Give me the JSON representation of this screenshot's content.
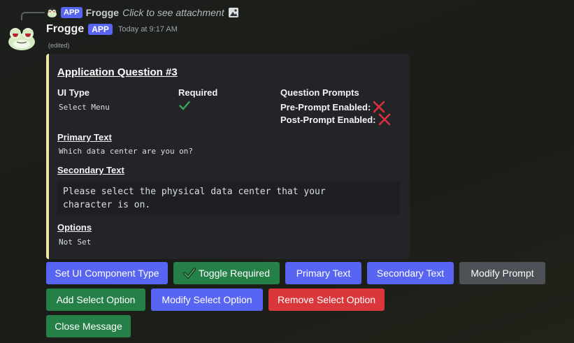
{
  "reply": {
    "badge": "APP",
    "author": "Frogge",
    "text": "Click to see attachment"
  },
  "message": {
    "author": "Frogge",
    "badge": "APP",
    "timestamp": "Today at 9:17 AM",
    "edited": "(edited)"
  },
  "embed": {
    "accent_color": "#f0e6a8",
    "title": "Application Question #3",
    "ui_type_label": "UI Type",
    "ui_type_value": "Select Menu",
    "required_label": "Required",
    "required_icon": "checkmark-icon",
    "prompts_label": "Question Prompts",
    "pre_prompt_label": "Pre-Prompt Enabled:",
    "pre_prompt_icon": "cross-icon",
    "post_prompt_label": "Post-Prompt Enabled:",
    "post_prompt_icon": "cross-icon",
    "primary_text_label": "Primary Text",
    "primary_text_value": "Which data center are you on?",
    "secondary_text_label": "Secondary Text",
    "secondary_text_value": "Please select the physical data center that your\ncharacter is on.",
    "options_label": "Options",
    "options_value": "Not Set"
  },
  "buttons": {
    "set_ui_component_type": "Set UI Component Type",
    "toggle_required": "Toggle Required",
    "primary_text": "Primary Text",
    "secondary_text": "Secondary Text",
    "modify_prompt": "Modify Prompt",
    "add_select_option": "Add Select Option",
    "modify_select_option": "Modify Select Option",
    "remove_select_option": "Remove Select Option",
    "close_message": "Close Message"
  },
  "colors": {
    "blurple": "#5865f2",
    "green": "#248046",
    "grey": "#4e5058",
    "red": "#da373c"
  }
}
